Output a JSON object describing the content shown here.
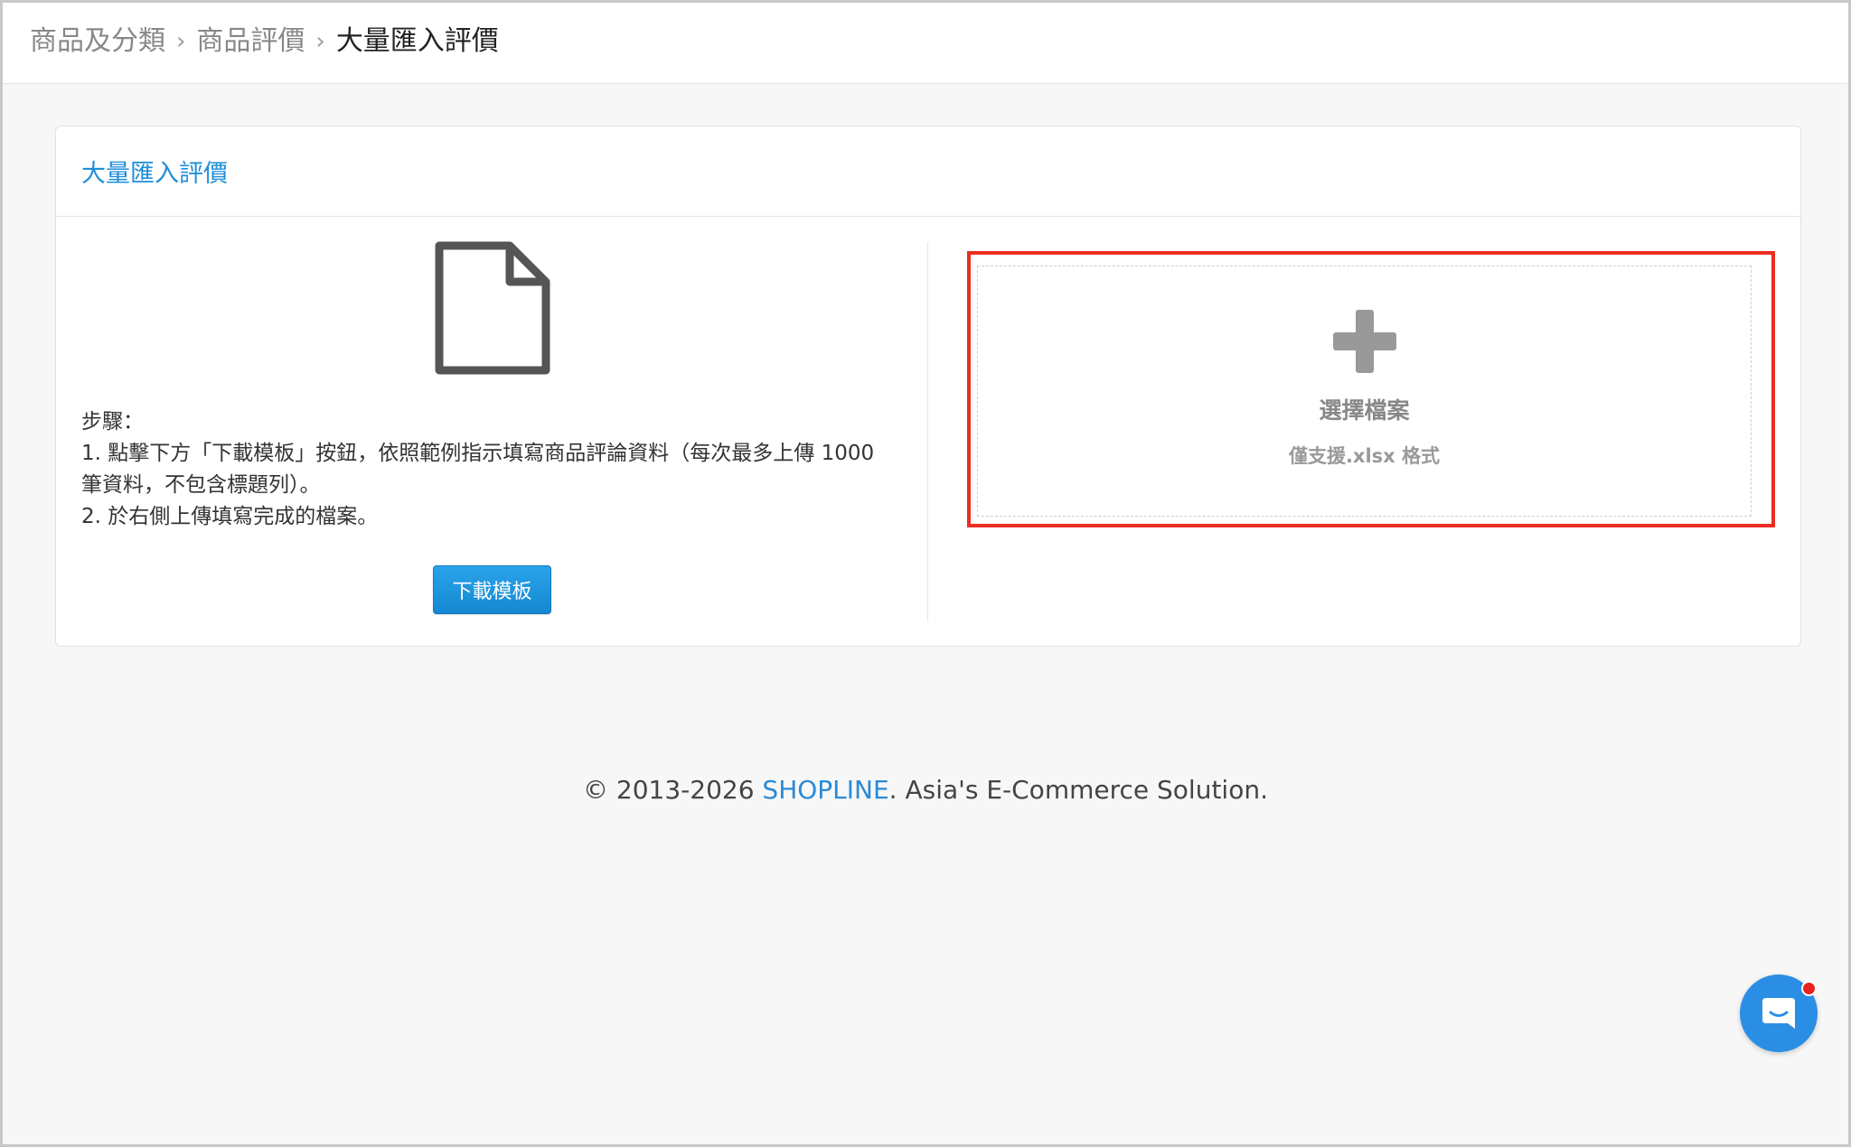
{
  "breadcrumb": {
    "items": [
      "商品及分類",
      "商品評價"
    ],
    "current": "大量匯入評價",
    "separator": "›"
  },
  "panel": {
    "title": "大量匯入評價",
    "steps_heading": "步驟：",
    "step_1": "1. 點擊下方「下載模板」按鈕，依照範例指示填寫商品評論資料（每次最多上傳 1000 筆資料，不包含標題列）。",
    "step_2": "2. 於右側上傳填寫完成的檔案。",
    "download_button": "下載模板",
    "dropzone_title": "選擇檔案",
    "dropzone_hint": "僅支援.xlsx 格式"
  },
  "footer": {
    "prefix": "© 2013-2026 ",
    "brand": "SHOPLINE",
    "suffix": ". Asia's E-Commerce Solution."
  },
  "icons": {
    "document": "document-icon",
    "plus": "plus-icon",
    "chat": "chat-icon"
  },
  "colors": {
    "accent": "#1f8ed8",
    "button": "#1488d2",
    "highlight": "#ea2f21",
    "chat": "#2b8ee5",
    "notification": "#e8221e"
  }
}
